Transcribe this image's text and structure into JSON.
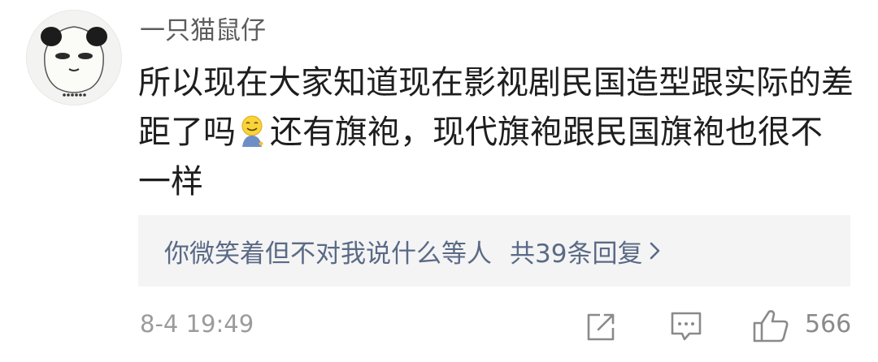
{
  "comment": {
    "username": "一只猫鼠仔",
    "text_part1": "所以现在大家知道现在影视剧民国造型跟实际的差距了吗",
    "emoji": "smiling-face-emoji",
    "text_part2": "还有旗袍，现代旗袍跟民国旗袍也很不一样",
    "replies": {
      "names": "你微笑着但不对我说什么等人",
      "count_label": "共39条回复"
    },
    "timestamp": "8-4 19:49",
    "likes": "566"
  },
  "icons": [
    "share-icon",
    "comment-icon",
    "thumbs-up-icon",
    "chevron-right-icon"
  ]
}
